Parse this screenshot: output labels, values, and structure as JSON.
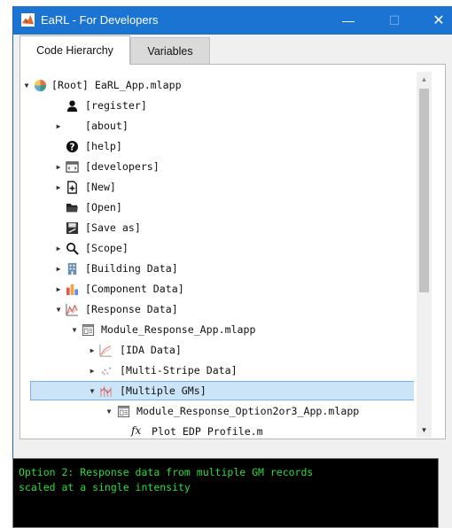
{
  "window": {
    "title": "EaRL - For Developers",
    "controls": {
      "minimize": "—",
      "maximize": "☐",
      "close": "✕"
    }
  },
  "tabs": [
    {
      "label": "Code Hierarchy",
      "active": true
    },
    {
      "label": "Variables",
      "active": false
    }
  ],
  "tree": {
    "items": [
      {
        "label": "[Root] EaRL_App.mlapp",
        "icon": "app-root-icon",
        "expander": "expanded"
      },
      {
        "label": "[register]",
        "icon": "user-icon",
        "expander": "none"
      },
      {
        "label": "[about]",
        "icon": "blank",
        "expander": "collapsed"
      },
      {
        "label": "[help]",
        "icon": "help-icon",
        "expander": "none"
      },
      {
        "label": "[developers]",
        "icon": "code-window-icon",
        "expander": "collapsed"
      },
      {
        "label": "[New]",
        "icon": "new-file-icon",
        "expander": "collapsed"
      },
      {
        "label": "[Open]",
        "icon": "folder-icon",
        "expander": "none"
      },
      {
        "label": "[Save as]",
        "icon": "save-icon",
        "expander": "none"
      },
      {
        "label": "[Scope]",
        "icon": "magnifier-icon",
        "expander": "collapsed"
      },
      {
        "label": "[Building Data]",
        "icon": "building-icon",
        "expander": "collapsed"
      },
      {
        "label": "[Component Data]",
        "icon": "component-icon",
        "expander": "collapsed"
      },
      {
        "label": "[Response Data]",
        "icon": "response-chart-icon",
        "expander": "expanded"
      },
      {
        "label": "Module_Response_App.mlapp",
        "icon": "module-file-icon",
        "expander": "expanded"
      },
      {
        "label": "[IDA Data]",
        "icon": "ida-chart-icon",
        "expander": "collapsed"
      },
      {
        "label": "[Multi-Stripe Data]",
        "icon": "stripe-chart-icon",
        "expander": "collapsed"
      },
      {
        "label": "[Multiple GMs]",
        "icon": "gm-chart-icon",
        "expander": "expanded",
        "selected": true
      },
      {
        "label": "Module_Response_Option2or3_App.mlapp",
        "icon": "module-file-icon",
        "expander": "expanded"
      },
      {
        "label": "Plot EDP Profile.m",
        "icon": "function-icon",
        "expander": "none"
      }
    ],
    "icon_glyphs": {
      "function": "fx"
    }
  },
  "console": {
    "lines": [
      "Option 2: Response data from multiple GM records",
      "scaled at a single intensity"
    ]
  },
  "colors": {
    "titlebar": "#1b74d2",
    "selection": "#cce4f7",
    "console_bg": "#000000",
    "console_text": "#2cdc3c"
  }
}
